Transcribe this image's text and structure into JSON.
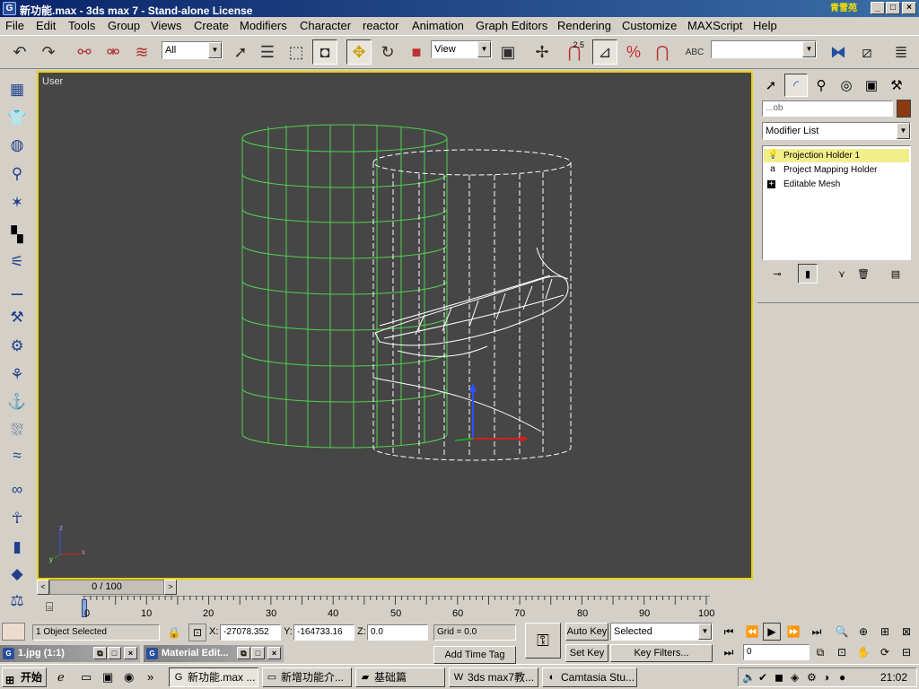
{
  "window": {
    "title": "新功能.max - 3ds max 7 - Stand-alone License",
    "logo_text": "青雪苑",
    "min": "_",
    "max": "□",
    "close": "×"
  },
  "menu": [
    "File",
    "Edit",
    "Tools",
    "Group",
    "Views",
    "Create",
    "Modifiers",
    "Character",
    "reactor",
    "Animation",
    "Graph Editors",
    "Rendering",
    "Customize",
    "MAXScript",
    "Help"
  ],
  "toolbar": {
    "selection_filter": "All",
    "ref_coord": "View",
    "named_sel": "",
    "snap_angle_label": "2.5",
    "percent_label": "%"
  },
  "viewport": {
    "label": "User",
    "axis_x": "x",
    "axis_y": "y",
    "axis_z": "z"
  },
  "command_panel": {
    "name_field": "...ob",
    "modifier_list": "Modifier List",
    "stack": [
      {
        "label": "Projection Holder 1",
        "icon": "lightbulb-icon",
        "glyph": "💡",
        "selected": true
      },
      {
        "label": "Project Mapping Holder",
        "icon": "holder-icon",
        "glyph": "a",
        "selected": false
      },
      {
        "label": "Editable Mesh",
        "icon": "expand-icon",
        "glyph": "+",
        "selected": false
      }
    ]
  },
  "time_slider": {
    "value": "0 / 100",
    "prev": "<",
    "next": ">"
  },
  "ruler": {
    "ticks": [
      "0",
      "10",
      "20",
      "30",
      "40",
      "50",
      "60",
      "70",
      "80",
      "90",
      "100"
    ]
  },
  "status": {
    "selection": "1 Object Selected",
    "x_label": "X:",
    "x_value": "-27078.352",
    "y_label": "Y:",
    "y_value": "-164733.16",
    "z_label": "Z:",
    "z_value": "0.0",
    "grid": "Grid = 0.0",
    "add_time_tag": "Add Time Tag",
    "auto_key": "Auto Key",
    "set_key": "Set Key",
    "key_mode": "Selected",
    "key_filters": "Key Filters...",
    "frame": "0"
  },
  "mdi": [
    {
      "label": "1.jpg (1:1)"
    },
    {
      "label": "Material Edit..."
    }
  ],
  "taskbar": {
    "start": "开始",
    "tasks": [
      "新功能.max ...",
      "新增功能介...",
      "基础篇",
      "3ds max7教...",
      "Camtasia Stu..."
    ],
    "clock": "21:02"
  }
}
